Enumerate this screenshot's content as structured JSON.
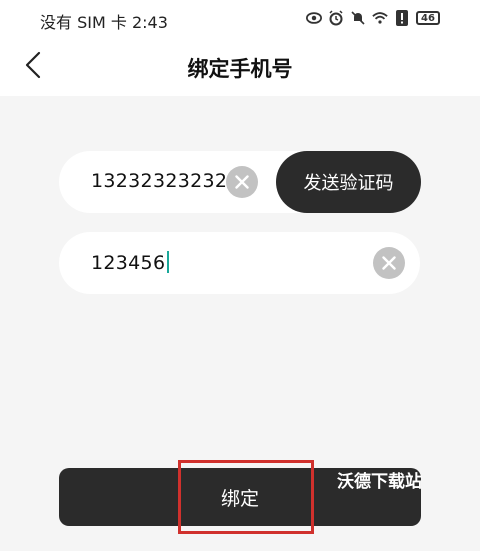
{
  "status_bar": {
    "text": "没有 SIM 卡 2:43",
    "battery": "46",
    "icons": [
      "eye-icon",
      "alarm-icon",
      "mute-icon",
      "wifi-icon",
      "alert-icon"
    ]
  },
  "header": {
    "title": "绑定手机号",
    "back_icon": "chevron-left-icon"
  },
  "phone_field": {
    "value": "13232323232",
    "clear_icon": "clear-circle-icon"
  },
  "send_code_button": {
    "label": "发送验证码"
  },
  "code_field": {
    "value": "123456",
    "clear_icon": "clear-circle-icon"
  },
  "bind_button": {
    "label": "绑定"
  },
  "watermark": {
    "text": "沃德下载站"
  },
  "colors": {
    "button_bg": "#2b2b2b",
    "page_bg": "#f5f5f5",
    "highlight": "#d0312d",
    "caret": "#1aa89a"
  }
}
